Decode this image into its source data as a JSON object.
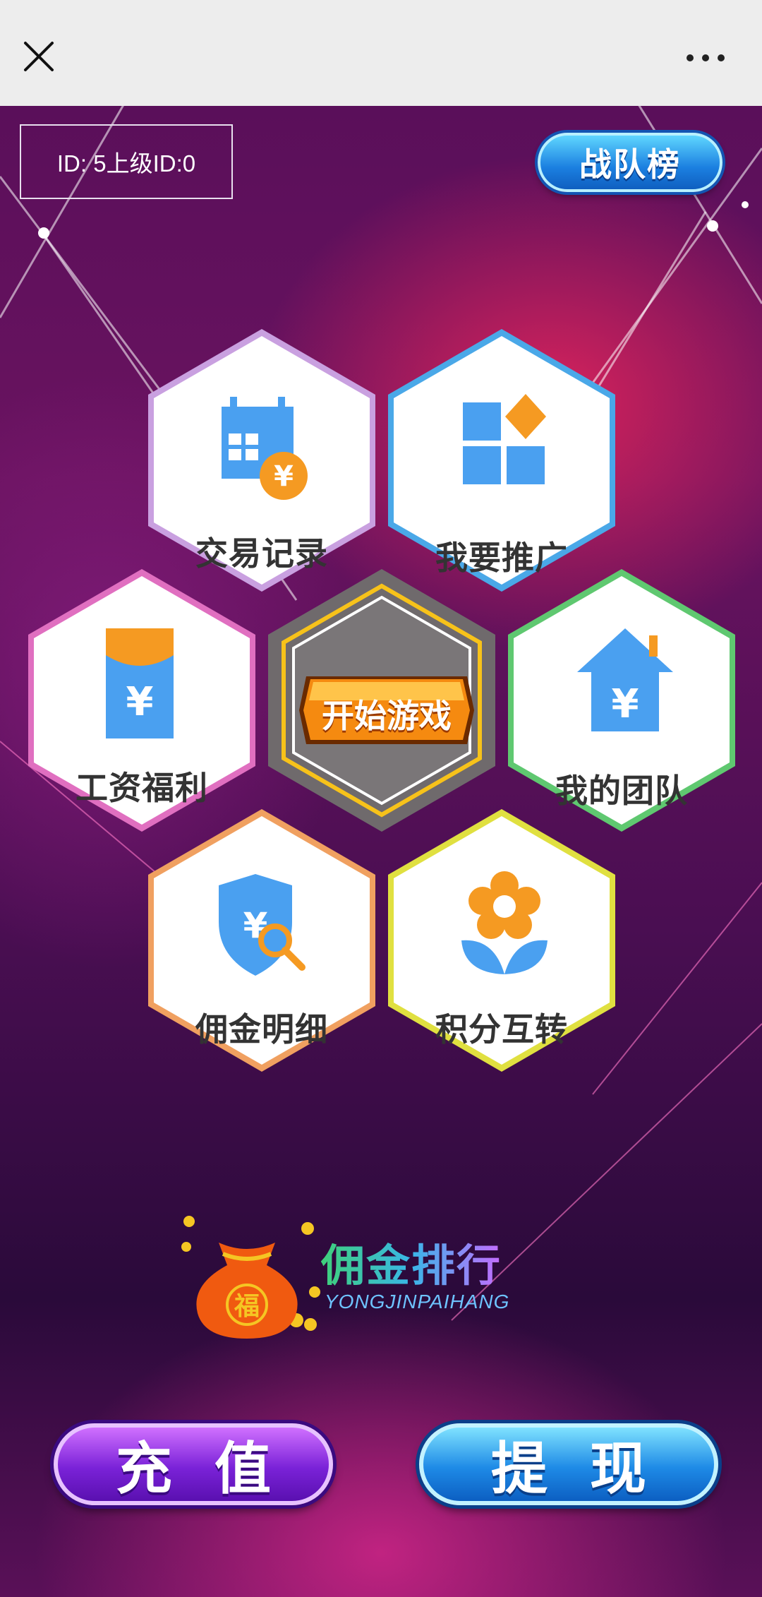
{
  "header": {
    "close_icon": "close-icon",
    "more_icon": "more-icon"
  },
  "user": {
    "id_text": "ID: 5上级ID:0"
  },
  "rank_button": {
    "label": "战队榜"
  },
  "menu": {
    "transaction": {
      "label": "交易记录",
      "icon": "calendar-yuan-icon",
      "color": "#c9a0e0"
    },
    "promote": {
      "label": "我要推广",
      "icon": "grid-diamond-icon",
      "color": "#4aa8e8"
    },
    "salary": {
      "label": "工资福利",
      "icon": "red-envelope-icon",
      "color": "#e06fc0"
    },
    "start_game": {
      "label": "开始游戏"
    },
    "team": {
      "label": "我的团队",
      "icon": "house-yuan-icon",
      "color": "#5fc870"
    },
    "commission": {
      "label": "佣金明细",
      "icon": "shield-search-icon",
      "color": "#f0a060"
    },
    "points": {
      "label": "积分互转",
      "icon": "flower-icon",
      "color": "#e0e040"
    }
  },
  "ranking_banner": {
    "title": "佣金排行",
    "subtitle": "YONGJINPAIHANG",
    "bag_char": "福"
  },
  "actions": {
    "recharge": "充值",
    "withdraw": "提现"
  }
}
